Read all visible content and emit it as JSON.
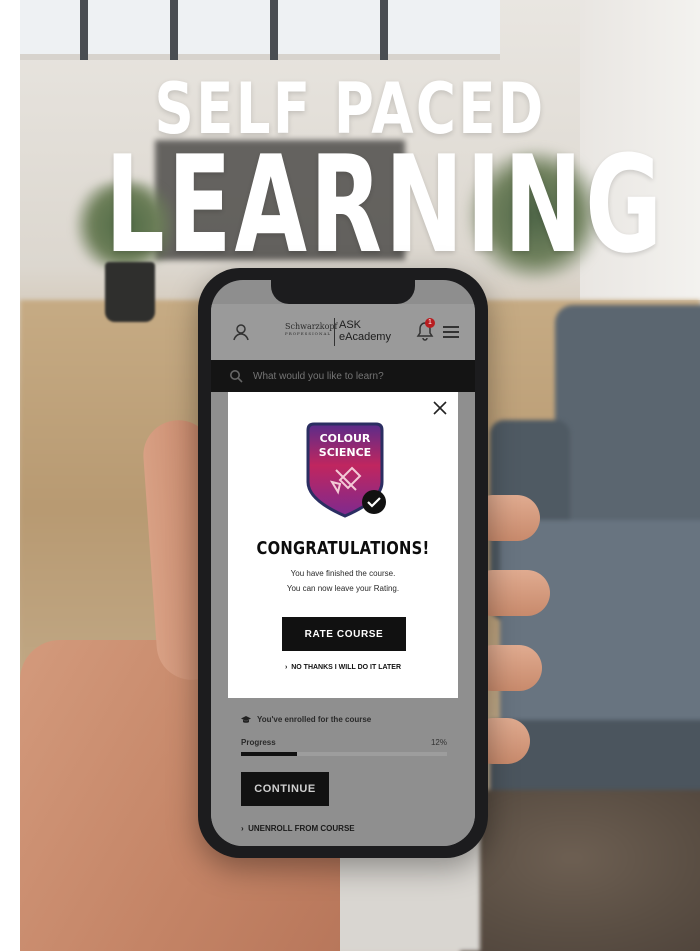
{
  "headline": {
    "line1": "SELF PACED",
    "line2": "LEARNING"
  },
  "app": {
    "brand_name": "Schwarzkopf",
    "brand_sub": "PROFESSIONAL",
    "product_line1": "ASK",
    "product_line2": "eAcademy",
    "notification_count": "1",
    "search_placeholder": "What would you like to learn?"
  },
  "modal": {
    "badge_line1": "COLOUR",
    "badge_line2": "SCIENCE",
    "title": "CONGRATULATIONS!",
    "message_line1": "You have finished the course.",
    "message_line2": "You can now leave your Rating.",
    "rate_button": "RATE COURSE",
    "dismiss_link": "NO THANKS I WILL DO IT LATER"
  },
  "course": {
    "enrolled_text": "You've enrolled for the course",
    "progress_label": "Progress",
    "progress_value": "12%",
    "progress_fraction": 0.27,
    "continue_button": "CONTINUE",
    "unenroll_link": "UNENROLL FROM COURSE"
  },
  "colors": {
    "badge_red": "#b81d20",
    "badge_purple": "#5d2a7a",
    "button_dark": "#111111"
  }
}
